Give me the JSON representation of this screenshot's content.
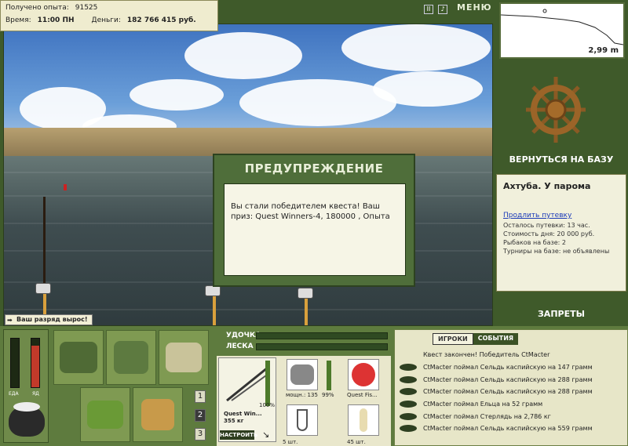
{
  "top": {
    "exp_label": "Получено опыта:",
    "exp_value": "91525",
    "time_label": "Время:",
    "time_value": "11:00 ПН",
    "money_label": "Деньги:",
    "money_value": "182 766 415 руб.",
    "menu": "МЕНЮ"
  },
  "depth": {
    "value": "2,99 m"
  },
  "base": {
    "return_button": "ВЕРНУТЬСЯ НА БАЗУ",
    "location": "Ахтуба. У парома",
    "extend_link": "Продлить путевку",
    "lines": [
      "Осталось путевки: 13 час.",
      "Стоимость дня: 20 000 руб.",
      "Рыбаков на базе: 2",
      "Турниры на базе: не объявлены"
    ],
    "bans_button": "ЗАПРЕТЫ"
  },
  "dialog": {
    "title": "ПРЕДУПРЕЖДЕНИЕ",
    "text": "Вы стали победителем квеста! Ваш приз: Quest Winners-4, 180000 , Опыта"
  },
  "rank_message": "Ваш разряд вырос!",
  "bars": {
    "food_label": "ЕДА",
    "poison_label": "ЯД",
    "food_level": 0.0,
    "poison_level": 0.85
  },
  "slots": {
    "num1": "1",
    "num2": "2",
    "num3": "3"
  },
  "tackle": {
    "rod_label": "УДОЧКА",
    "line_label": "ЛЕСКА",
    "rod_name": "Quest Win...",
    "rod_weight": "355 кг",
    "rod_pct": "100%",
    "reel_caption": "мощн.: 135",
    "reel_pct": "99%",
    "line_caption": "Quest Fis...",
    "hook_count": "5 шт.",
    "bait_count": "45 шт.",
    "setup_button": "НАСТРОИТЬ"
  },
  "chat": {
    "tab_players": "ИГРОКИ",
    "tab_events": "СОБЫТИЯ",
    "messages": [
      "Квест закончен! Победитель CtMacter",
      "CtMacter поймал Сельдь каспийскую на 147 грамм",
      "CtMacter поймал Сельдь каспийскую на 288 грамм",
      "CtMacter поймал Сельдь каспийскую на 288 грамм",
      "CtMacter поймал Ельца на 52 грамм",
      "CtMacter поймал Стерлядь на 2,786 кг",
      "CtMacter поймал Сельдь каспийскую на 559 грамм"
    ]
  },
  "colors": {
    "panel_green": "#3f5a2a",
    "accent_red": "#c23a2a"
  }
}
